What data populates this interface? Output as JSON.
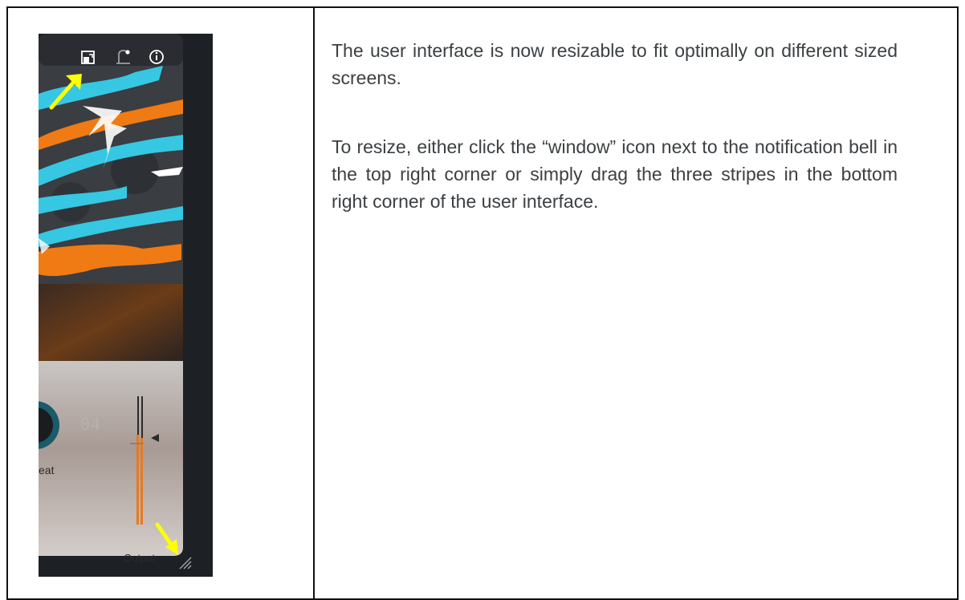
{
  "document": {
    "paragraph_1": "The user interface is now resizable to fit optimally on different sized screens.",
    "paragraph_2": "To resize, either click the “window” icon next to the notification bell in the top right corner or simply drag the three stripes in the bottom right corner of the user interface."
  },
  "plugin_screenshot": {
    "preset_number": "04",
    "knob_label": "eat",
    "meter_label": "Output",
    "icons": [
      "window-resize-icon",
      "notification-bell-icon",
      "info-icon"
    ],
    "annotation_color": "#ffff00",
    "colors": {
      "cyan": "#36c7e3",
      "orange": "#f07a14",
      "panel": "#bdb6b1",
      "frame": "#1d2024"
    }
  }
}
